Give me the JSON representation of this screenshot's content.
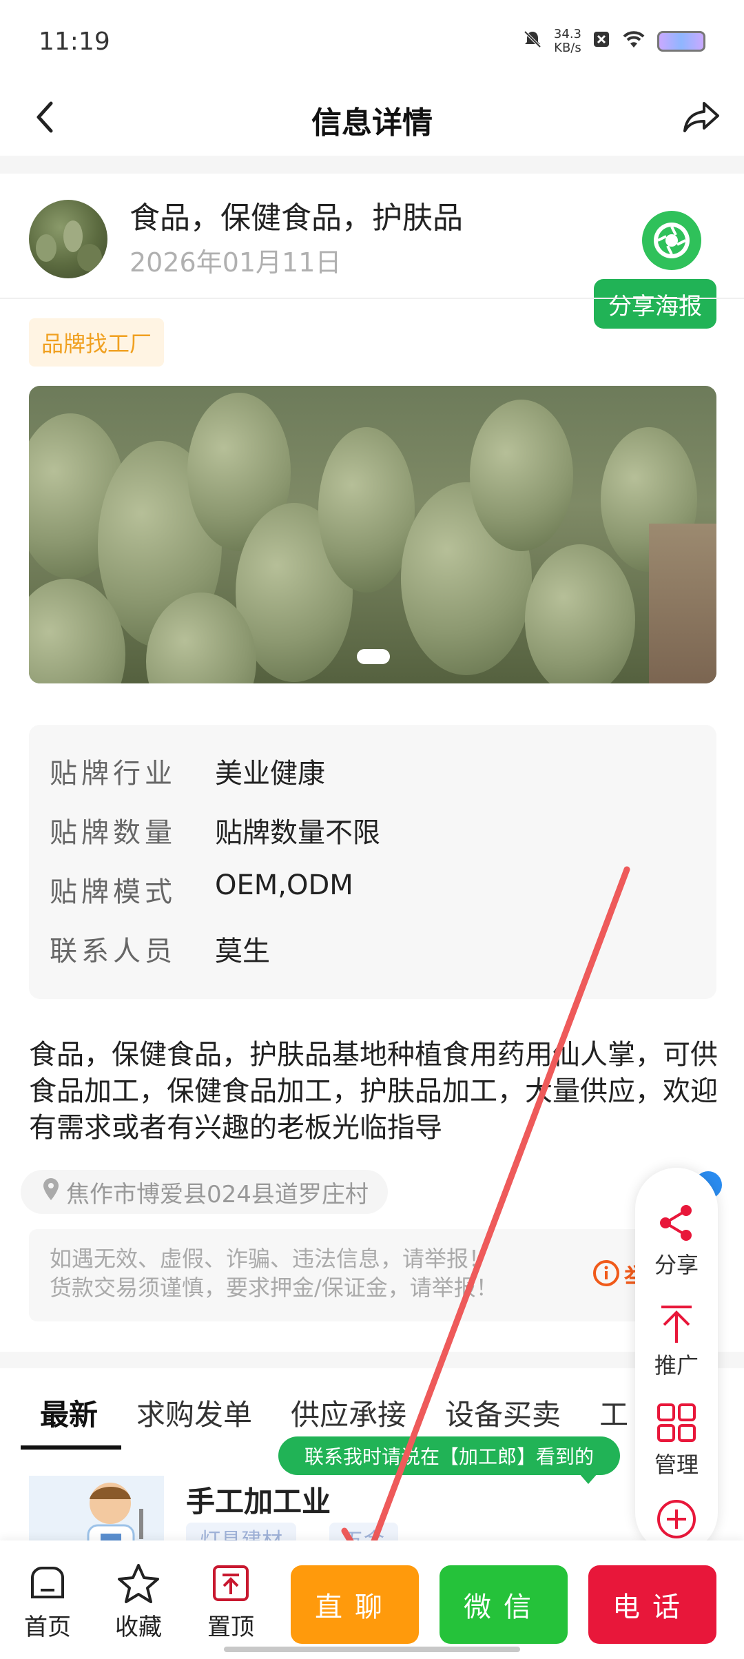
{
  "status_bar": {
    "time": "11:19",
    "speed": "34.3",
    "speed_unit": "KB/s"
  },
  "navbar": {
    "title": "信息详情"
  },
  "post": {
    "title": "食品，保健食品，护肤品",
    "date": "2026年01月11日",
    "share_poster": "分享海报",
    "tag": "品牌找工厂"
  },
  "info": [
    {
      "key": "贴牌行业",
      "value": "美业健康"
    },
    {
      "key": "贴牌数量",
      "value": "贴牌数量不限"
    },
    {
      "key": "贴牌模式",
      "value": "OEM,ODM"
    },
    {
      "key": "联系人员",
      "value": "莫生"
    }
  ],
  "description": "食品，保健食品，护肤品基地种植食用药用仙人掌，可供食品加工，保健食品加工，护肤品加工，大量供应，欢迎有需求或者有兴趣的老板光临指导",
  "address": "焦作市博爱县024县道罗庄村",
  "warning": {
    "line1": "如遇无效、虚假、诈骗、违法信息，请举报！",
    "line2": "货款交易须谨慎，要求押金/保证金，请举报！",
    "report": "举"
  },
  "tabs": [
    "最新",
    "求购发单",
    "供应承接",
    "设备买卖",
    "工"
  ],
  "banner": "联系我时请说在【加工郎】看到的",
  "list_item": {
    "title": "手工加工业",
    "chips": [
      "灯具建材",
      "五金"
    ]
  },
  "side_menu": {
    "share": "分享",
    "promote": "推广",
    "manage": "管理"
  },
  "bottom": {
    "home": "首页",
    "favorite": "收藏",
    "top": "置顶",
    "chat": "直聊",
    "wechat": "微信",
    "phone": "电话"
  },
  "colors": {
    "green": "#21b356",
    "orange": "#ff9a0c",
    "wechat_green": "#25c23a",
    "red": "#e8173a"
  }
}
